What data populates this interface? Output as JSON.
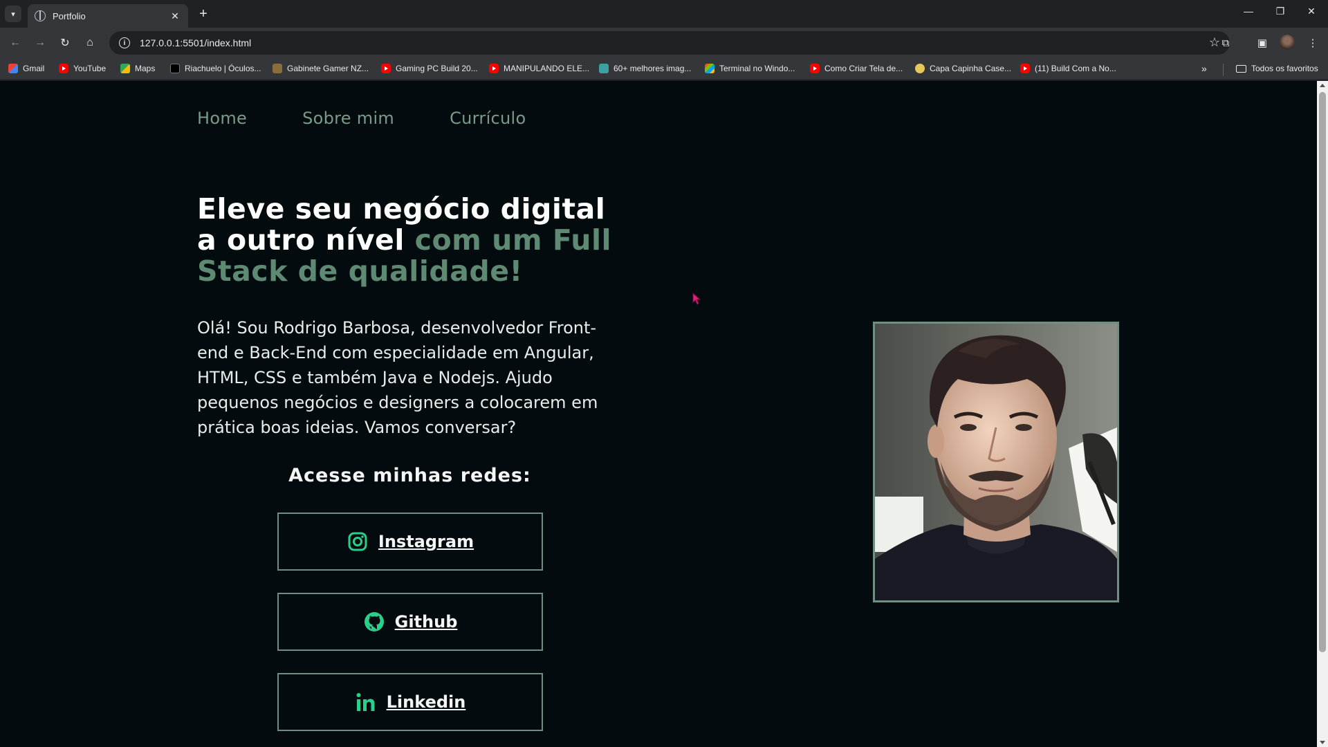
{
  "browser": {
    "tab_title": "Portfolio",
    "url": "127.0.0.1:5501/index.html",
    "bookmarks": [
      {
        "label": "Gmail",
        "icon": "gmail-icon"
      },
      {
        "label": "YouTube",
        "icon": "youtube-icon"
      },
      {
        "label": "Maps",
        "icon": "maps-icon"
      },
      {
        "label": "Riachuelo | Óculos...",
        "icon": "riachuelo-icon"
      },
      {
        "label": "Gabinete Gamer NZ...",
        "icon": "site-icon"
      },
      {
        "label": "Gaming PC Build 20...",
        "icon": "youtube-icon"
      },
      {
        "label": "MANIPULANDO ELE...",
        "icon": "youtube-icon"
      },
      {
        "label": "60+ melhores imag...",
        "icon": "site-icon"
      },
      {
        "label": "Terminal no Windo...",
        "icon": "site-icon"
      },
      {
        "label": "Como Criar Tela de...",
        "icon": "youtube-icon"
      },
      {
        "label": "Capa Capinha Case...",
        "icon": "site-icon"
      },
      {
        "label": "(11) Build Com a No...",
        "icon": "youtube-icon"
      }
    ],
    "all_bookmarks_label": "Todos os favoritos"
  },
  "site": {
    "nav": [
      "Home",
      "Sobre mim",
      "Currículo"
    ],
    "hero": {
      "title_white": "Eleve seu negócio digital a outro nível",
      "title_accent": "com um Full Stack de qualidade!",
      "text": "Olá! Sou Rodrigo Barbosa, desenvolvedor Front-end e Back-End com especialidade em Angular, HTML, CSS e também Java e Nodejs. Ajudo pequenos negócios e designers a colocarem em prática boas ideias. Vamos conversar?"
    },
    "social": {
      "title": "Acesse minhas redes:",
      "links": [
        {
          "label": "Instagram",
          "icon": "instagram-icon"
        },
        {
          "label": "Github",
          "icon": "github-icon"
        },
        {
          "label": "Linkedin",
          "icon": "linkedin-icon"
        }
      ]
    }
  },
  "colors": {
    "page_bg": "#040b0f",
    "accent": "#5e8a74",
    "icon_green": "#29d08a",
    "border": "#6f8f80"
  }
}
